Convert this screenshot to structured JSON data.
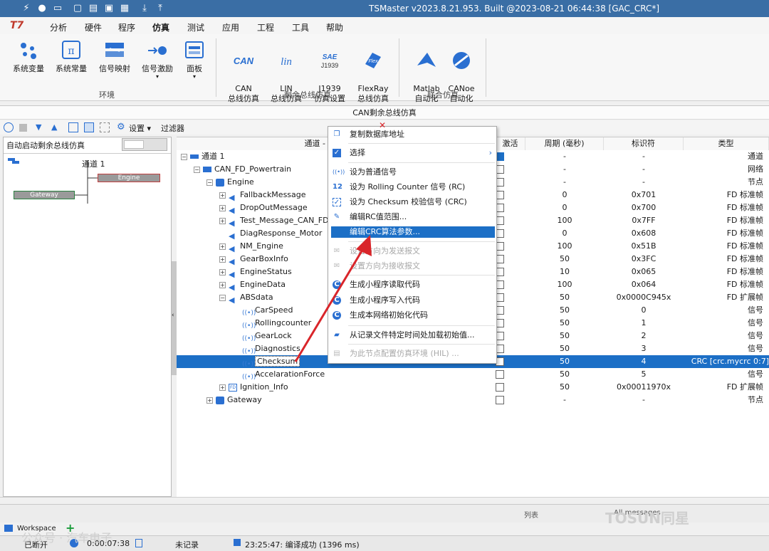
{
  "window": {
    "title": "TSMaster v2023.8.21.953. Built @2023-08-21 06:44:38 [GAC_CRC*]"
  },
  "menu": {
    "items": [
      "分析",
      "硬件",
      "程序",
      "仿真",
      "测试",
      "应用",
      "工程",
      "工具",
      "帮助"
    ],
    "active": "仿真"
  },
  "ribbon": {
    "buttons": [
      {
        "label": "系统变量",
        "icon": "system-variable-icon"
      },
      {
        "label": "系统常量",
        "icon": "system-constant-icon"
      },
      {
        "label": "信号映射",
        "icon": "signal-mapping-icon"
      },
      {
        "label": "信号激励",
        "icon": "signal-stimulus-icon"
      },
      {
        "label": "面板",
        "icon": "panel-icon"
      },
      {
        "label": "CAN\n总线仿真",
        "icon": "can-icon"
      },
      {
        "label": "LIN\n总线仿真",
        "icon": "lin-icon"
      },
      {
        "label": "J1939\n仿真设置",
        "icon": "j1939-icon"
      },
      {
        "label": "FlexRay\n总线仿真",
        "icon": "flexray-icon"
      },
      {
        "label": "Matlab\n自动化",
        "icon": "matlab-icon"
      },
      {
        "label": "CANoe\n自动化",
        "icon": "canoe-icon"
      }
    ],
    "groups": [
      "环境",
      "剩余总线仿真",
      "联合仿真"
    ]
  },
  "panel": {
    "title": "CAN剩余总线仿真",
    "settings_label": "设置",
    "filter_label": "过滤器"
  },
  "left": {
    "auto_start_label": "自动启动剩余总线仿真",
    "channel_label": "通道 1",
    "engine_node": "Engine",
    "gateway_node": "Gateway"
  },
  "grid": {
    "headers": {
      "name": "通道 - 网络 - 节点",
      "active": "激活",
      "period": "周期 (毫秒)",
      "id": "标识符",
      "type": "类型"
    },
    "rows": [
      {
        "name": "通道 1",
        "period": "-",
        "id": "-",
        "type": "通道"
      },
      {
        "name": "CAN_FD_Powertrain",
        "period": "-",
        "id": "-",
        "type": "网络"
      },
      {
        "name": "Engine",
        "period": "-",
        "id": "-",
        "type": "节点"
      },
      {
        "name": "FallbackMessage",
        "period": "0",
        "id": "0x701",
        "type": "FD 标准帧"
      },
      {
        "name": "DropOutMessage",
        "period": "0",
        "id": "0x700",
        "type": "FD 标准帧"
      },
      {
        "name": "Test_Message_CAN_FD",
        "period": "100",
        "id": "0x7FF",
        "type": "FD 标准帧"
      },
      {
        "name": "DiagResponse_Motor",
        "period": "0",
        "id": "0x608",
        "type": "FD 标准帧"
      },
      {
        "name": "NM_Engine",
        "period": "100",
        "id": "0x51B",
        "type": "FD 标准帧"
      },
      {
        "name": "GearBoxInfo",
        "period": "50",
        "id": "0x3FC",
        "type": "FD 标准帧"
      },
      {
        "name": "EngineStatus",
        "period": "10",
        "id": "0x065",
        "type": "FD 标准帧"
      },
      {
        "name": "EngineData",
        "period": "100",
        "id": "0x064",
        "type": "FD 标准帧"
      },
      {
        "name": "ABSdata",
        "period": "50",
        "id": "0x0000C945x",
        "type": "FD 扩展帧"
      },
      {
        "name": "CarSpeed",
        "period": "50",
        "id": "0",
        "type": "信号"
      },
      {
        "name": "Rollingcounter",
        "period": "50",
        "id": "1",
        "type": "信号"
      },
      {
        "name": "GearLock",
        "period": "50",
        "id": "2",
        "type": "信号"
      },
      {
        "name": "Diagnostics",
        "period": "50",
        "id": "3",
        "type": "信号"
      },
      {
        "name": "Checksum",
        "period": "50",
        "id": "4",
        "type": "CRC [crc.mycrc 0:7]"
      },
      {
        "name": "AccelarationForce",
        "period": "50",
        "id": "5",
        "type": "信号"
      },
      {
        "name": "Ignition_Info",
        "period": "50",
        "id": "0x00011970x",
        "type": "FD 扩展帧"
      },
      {
        "name": "Gateway",
        "period": "-",
        "id": "-",
        "type": "节点"
      }
    ]
  },
  "context_menu": {
    "items": [
      {
        "label": "复制数据库地址",
        "icon": "copy-icon"
      },
      {
        "label": "选择",
        "icon": "check-icon"
      },
      {
        "label": "设为普通信号",
        "icon": "signal-icon"
      },
      {
        "label": "设为 Rolling Counter 信号 (RC)",
        "icon": "rc-icon"
      },
      {
        "label": "设为 Checksum 校验信号 (CRC)",
        "icon": "crc-icon"
      },
      {
        "label": "编辑RC值范围...",
        "icon": "edit-icon"
      },
      {
        "label": "编辑CRC算法参数...",
        "icon": "edit-crc-icon"
      },
      {
        "label": "设置方向为发送报文",
        "icon": "send-icon"
      },
      {
        "label": "设置方向为接收报文",
        "icon": "receive-icon"
      },
      {
        "label": "生成小程序读取代码",
        "icon": "code-icon"
      },
      {
        "label": "生成小程序写入代码",
        "icon": "code-icon"
      },
      {
        "label": "生成本网络初始化代码",
        "icon": "code-icon"
      },
      {
        "label": "从记录文件特定时间处加载初始值...",
        "icon": "load-icon"
      },
      {
        "label": "为此节点配置仿真环境 (HIL) ...",
        "icon": "hil-icon"
      }
    ]
  },
  "bottom": {
    "workspace_label": "Workspace",
    "list_label": "列表",
    "status_right": "All messages"
  },
  "status": {
    "connection": "已断开",
    "time": "0:00:07:38",
    "record": "未记录",
    "message": "23:25:47: 编译成功 (1396 ms)"
  },
  "watermark": {
    "left": "公众号 · 汽车电子",
    "right": "TOSUN同星"
  },
  "colors": {
    "accent": "#1c6fc6",
    "titlebar": "#3a6ea5",
    "arrow": "#d9252a"
  }
}
